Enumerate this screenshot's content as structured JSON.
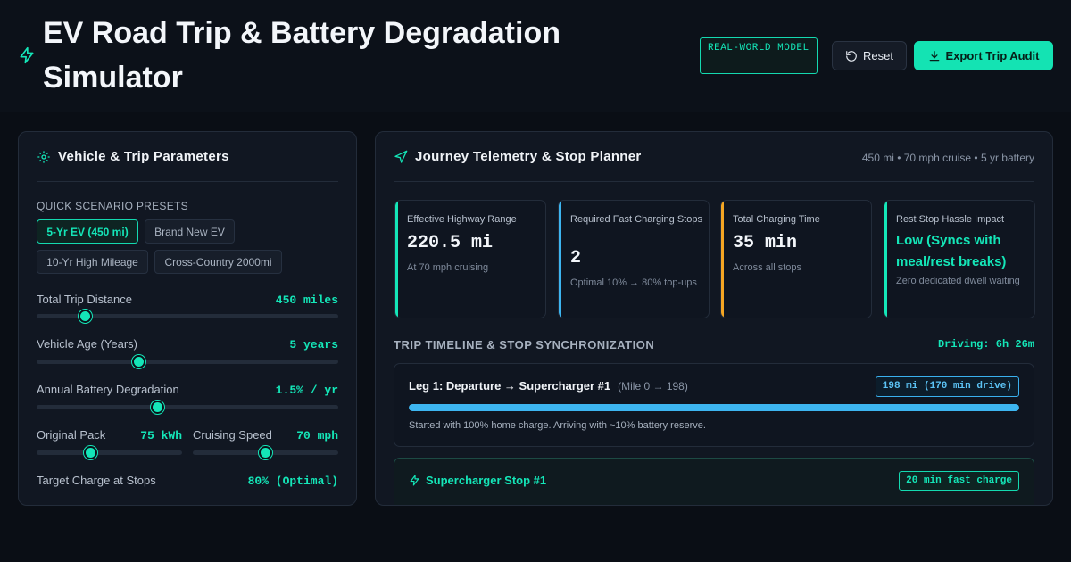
{
  "header": {
    "title": "EV Road Trip & Battery Degradation Simulator",
    "model_badge": "REAL-WORLD MODEL",
    "reset_label": "Reset",
    "export_label": "Export Trip Audit"
  },
  "params": {
    "title": "Vehicle & Trip Parameters",
    "presets_label": "QUICK SCENARIO PRESETS",
    "presets": [
      "5-Yr EV (450 mi)",
      "Brand New EV",
      "10-Yr High Mileage",
      "Cross-Country 2000mi"
    ],
    "active_preset": "5-Yr EV (450 mi)",
    "distance": {
      "label": "Total Trip Distance",
      "value": "450 miles",
      "fraction": 0.16
    },
    "age": {
      "label": "Vehicle Age (Years)",
      "value": "5 years",
      "fraction": 0.34
    },
    "degradation": {
      "label": "Annual Battery Degradation",
      "value": "1.5% / yr",
      "fraction": 0.4
    },
    "pack": {
      "label": "Original Pack",
      "value": "75 kWh",
      "fraction": 0.37
    },
    "speed": {
      "label": "Cruising Speed",
      "value": "70 mph",
      "fraction": 0.5
    },
    "target_charge": {
      "label": "Target Charge at Stops",
      "value": "80% (Optimal)"
    }
  },
  "telemetry": {
    "title": "Journey Telemetry & Stop Planner",
    "meta": "450 mi • 70 mph cruise • 5 yr battery",
    "stats": [
      {
        "label": "Effective Highway Range",
        "value": "220.5 mi",
        "sub": "At 70 mph cruising",
        "color": "#14e6b8"
      },
      {
        "label": "Required Fast Charging Stops",
        "value": "2",
        "sub": "Optimal 10% → 80% top-ups",
        "color": "#3db5f0"
      },
      {
        "label": "Total Charging Time",
        "value": "35 min",
        "sub": "Across all stops",
        "color": "#f5a623"
      },
      {
        "label": "Rest Stop Hassle Impact",
        "value": "Low (Syncs with meal/rest breaks)",
        "sub": "Zero dedicated dwell waiting",
        "color": "#14e6b8"
      }
    ],
    "timeline_label": "TRIP TIMELINE & STOP SYNCHRONIZATION",
    "driving": "Driving: 6h 26m",
    "leg1": {
      "title": "Leg 1: Departure → Supercharger #1",
      "range": "(Mile 0 → 198)",
      "badge": "198 mi (170 min drive)",
      "progress": 1.0,
      "desc": "Started with 100% home charge. Arriving with ~10% battery reserve."
    },
    "stop1": {
      "title": "Supercharger Stop #1",
      "badge": "20 min fast charge"
    }
  }
}
